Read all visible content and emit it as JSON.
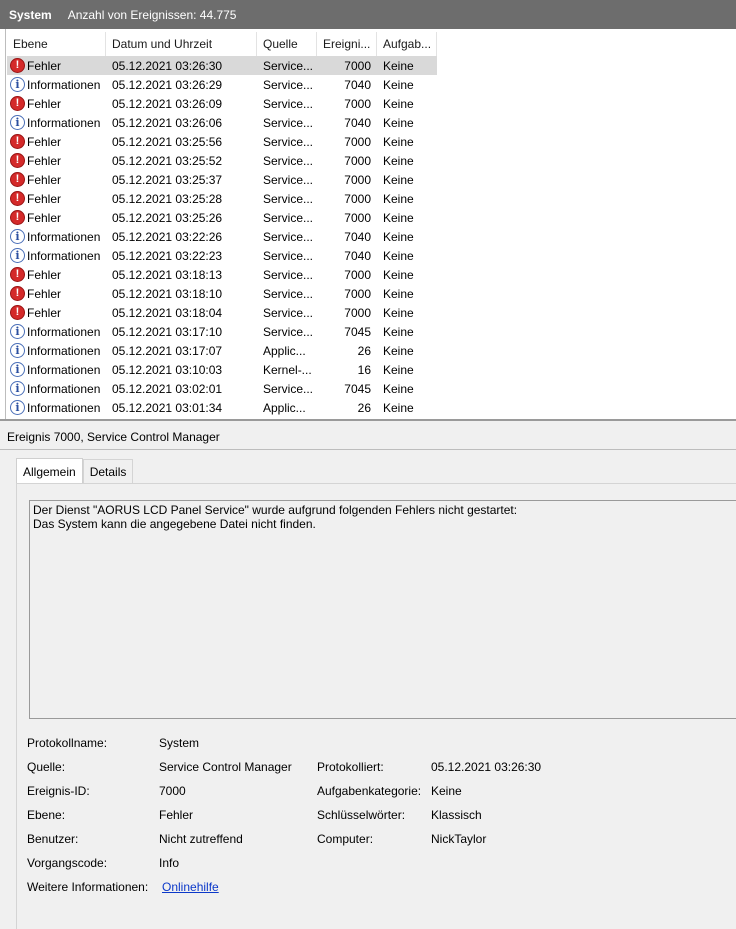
{
  "titlebar": {
    "log_name": "System",
    "event_count": "Anzahl von Ereignissen: 44.775"
  },
  "columns": [
    "Ebene",
    "Datum und Uhrzeit",
    "Quelle",
    "Ereigni...",
    "Aufgab..."
  ],
  "rows": [
    {
      "level": "Fehler",
      "type": "error",
      "date": "05.12.2021 03:26:30",
      "source": "Service...",
      "id": "7000",
      "task": "Keine"
    },
    {
      "level": "Informationen",
      "type": "info",
      "date": "05.12.2021 03:26:29",
      "source": "Service...",
      "id": "7040",
      "task": "Keine"
    },
    {
      "level": "Fehler",
      "type": "error",
      "date": "05.12.2021 03:26:09",
      "source": "Service...",
      "id": "7000",
      "task": "Keine"
    },
    {
      "level": "Informationen",
      "type": "info",
      "date": "05.12.2021 03:26:06",
      "source": "Service...",
      "id": "7040",
      "task": "Keine"
    },
    {
      "level": "Fehler",
      "type": "error",
      "date": "05.12.2021 03:25:56",
      "source": "Service...",
      "id": "7000",
      "task": "Keine"
    },
    {
      "level": "Fehler",
      "type": "error",
      "date": "05.12.2021 03:25:52",
      "source": "Service...",
      "id": "7000",
      "task": "Keine"
    },
    {
      "level": "Fehler",
      "type": "error",
      "date": "05.12.2021 03:25:37",
      "source": "Service...",
      "id": "7000",
      "task": "Keine"
    },
    {
      "level": "Fehler",
      "type": "error",
      "date": "05.12.2021 03:25:28",
      "source": "Service...",
      "id": "7000",
      "task": "Keine"
    },
    {
      "level": "Fehler",
      "type": "error",
      "date": "05.12.2021 03:25:26",
      "source": "Service...",
      "id": "7000",
      "task": "Keine"
    },
    {
      "level": "Informationen",
      "type": "info",
      "date": "05.12.2021 03:22:26",
      "source": "Service...",
      "id": "7040",
      "task": "Keine"
    },
    {
      "level": "Informationen",
      "type": "info",
      "date": "05.12.2021 03:22:23",
      "source": "Service...",
      "id": "7040",
      "task": "Keine"
    },
    {
      "level": "Fehler",
      "type": "error",
      "date": "05.12.2021 03:18:13",
      "source": "Service...",
      "id": "7000",
      "task": "Keine"
    },
    {
      "level": "Fehler",
      "type": "error",
      "date": "05.12.2021 03:18:10",
      "source": "Service...",
      "id": "7000",
      "task": "Keine"
    },
    {
      "level": "Fehler",
      "type": "error",
      "date": "05.12.2021 03:18:04",
      "source": "Service...",
      "id": "7000",
      "task": "Keine"
    },
    {
      "level": "Informationen",
      "type": "info",
      "date": "05.12.2021 03:17:10",
      "source": "Service...",
      "id": "7045",
      "task": "Keine"
    },
    {
      "level": "Informationen",
      "type": "info",
      "date": "05.12.2021 03:17:07",
      "source": "Applic...",
      "id": "26",
      "task": "Keine"
    },
    {
      "level": "Informationen",
      "type": "info",
      "date": "05.12.2021 03:10:03",
      "source": "Kernel-...",
      "id": "16",
      "task": "Keine"
    },
    {
      "level": "Informationen",
      "type": "info",
      "date": "05.12.2021 03:02:01",
      "source": "Service...",
      "id": "7045",
      "task": "Keine"
    },
    {
      "level": "Informationen",
      "type": "info",
      "date": "05.12.2021 03:01:34",
      "source": "Applic...",
      "id": "26",
      "task": "Keine"
    }
  ],
  "icons": {
    "error": "error-icon",
    "info": "info-icon"
  },
  "colors": {
    "error": "#d42a2a",
    "info": "#4a6fb8",
    "link": "#0b38c9",
    "selected_row": "#d9d9d9"
  },
  "detail": {
    "title": "Ereignis 7000, Service Control Manager",
    "tabs": [
      "Allgemein",
      "Details"
    ],
    "description_line1": "Der Dienst \"AORUS LCD Panel Service\" wurde aufgrund folgenden Fehlers nicht gestartet:",
    "description_line2": "Das System kann die angegebene Datei nicht finden.",
    "props": {
      "protokollname_label": "Protokollname:",
      "protokollname": "System",
      "quelle_label": "Quelle:",
      "quelle": "Service Control Manager",
      "protokolliert_label": "Protokolliert:",
      "protokolliert": "05.12.2021 03:26:30",
      "ereignis_id_label": "Ereignis-ID:",
      "ereignis_id": "7000",
      "aufgabenkategorie_label": "Aufgabenkategorie:",
      "aufgabenkategorie": "Keine",
      "ebene_label": "Ebene:",
      "ebene": "Fehler",
      "schluesselwoerter_label": "Schlüsselwörter:",
      "schluesselwoerter": "Klassisch",
      "benutzer_label": "Benutzer:",
      "benutzer": "Nicht zutreffend",
      "computer_label": "Computer:",
      "computer": "NickTaylor",
      "vorgangscode_label": "Vorgangscode:",
      "vorgangscode": "Info",
      "weitere_label": "Weitere Informationen:",
      "weitere_link": "Onlinehilfe"
    }
  }
}
